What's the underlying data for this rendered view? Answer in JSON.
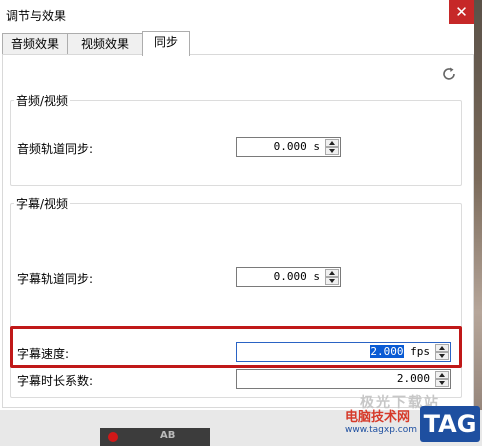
{
  "window": {
    "title": "调节与效果"
  },
  "tabs": [
    {
      "label": "音频效果"
    },
    {
      "label": "视频效果"
    },
    {
      "label": "同步"
    }
  ],
  "audio_video": {
    "group_label": "音频/视频",
    "track_sync_label": "音频轨道同步:",
    "track_sync_value": "0.000 s"
  },
  "subtitle_video": {
    "group_label": "字幕/视频",
    "track_sync_label": "字幕轨道同步:",
    "track_sync_value": "0.000 s",
    "speed_label": "字幕速度:",
    "speed_value": "2.000",
    "speed_unit": "fps",
    "duration_label": "字幕时长系数:",
    "duration_value": "2.000"
  },
  "watermark": {
    "line1": "电脑技术网",
    "line2": "www.tagxp.com",
    "tag": "TAG",
    "faint": "极光下载站"
  },
  "player_bar": {
    "ab": "AB"
  },
  "colors": {
    "highlight": "#c01818",
    "selection": "#0a5bd4",
    "close": "#c62828"
  }
}
